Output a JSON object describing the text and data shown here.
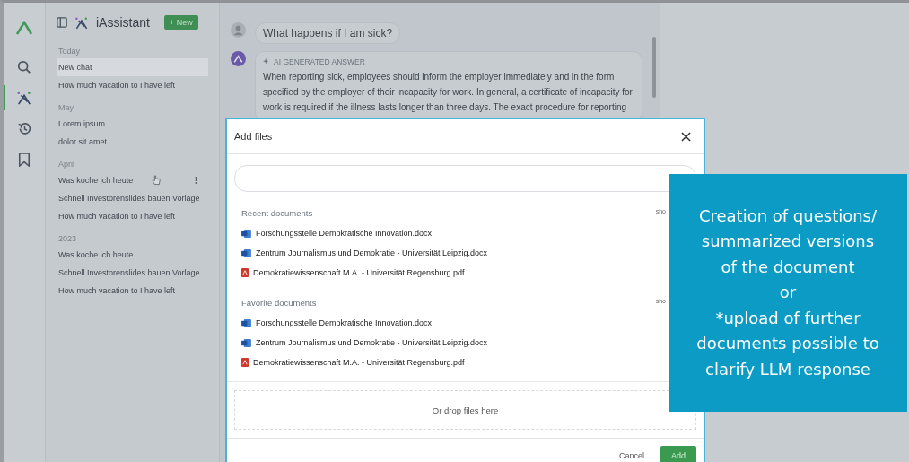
{
  "rail": {
    "items": [
      {
        "kind": "search",
        "selected": false
      },
      {
        "kind": "assistant",
        "selected": true
      },
      {
        "kind": "history",
        "selected": false
      },
      {
        "kind": "bookmark",
        "selected": false
      }
    ]
  },
  "sidebar": {
    "title": "iAssistant",
    "new_button": "+ New",
    "sections": [
      {
        "heading": "Today",
        "items": [
          {
            "label": "New chat",
            "selected": true,
            "menu_visible": false
          },
          {
            "label": "How much vacation to I have left",
            "selected": false,
            "menu_visible": false
          }
        ]
      },
      {
        "heading": "May",
        "items": [
          {
            "label": "Lorem ipsum",
            "selected": false,
            "menu_visible": false
          },
          {
            "label": "dolor sit amet",
            "selected": false,
            "menu_visible": false
          }
        ]
      },
      {
        "heading": "April",
        "items": [
          {
            "label": "Was koche ich heute",
            "selected": false,
            "menu_visible": true
          },
          {
            "label": "Schnell Investorenslides bauen Vorlage",
            "selected": false,
            "menu_visible": false
          },
          {
            "label": "How much vacation to I have left",
            "selected": false,
            "menu_visible": false
          }
        ]
      },
      {
        "heading": "2023",
        "items": [
          {
            "label": "Was koche ich heute",
            "selected": false,
            "menu_visible": false
          },
          {
            "label": "Schnell Investorenslides bauen Vorlage",
            "selected": false,
            "menu_visible": false
          },
          {
            "label": "How much vacation to I have left",
            "selected": false,
            "menu_visible": false
          }
        ]
      }
    ]
  },
  "chat": {
    "question": "What happens if I am sick?",
    "answer_label": "AI GENERATED ANSWER",
    "answer": "When reporting sick, employees should inform the employer immediately and in the form specified by the employer of their incapacity for work. In general, a certificate of incapacity for work is required if the illness lasts longer than three days. The exact procedure for reporting"
  },
  "dialog": {
    "title": "Add files",
    "sections": [
      {
        "heading": "Recent documents",
        "link": "sho",
        "files": [
          {
            "kind": "docx",
            "name": "Forschungsstelle Demokratische Innovation.docx"
          },
          {
            "kind": "docx",
            "name": "Zentrum Journalismus und Demokratie - Universität Leipzig.docx"
          },
          {
            "kind": "pdf",
            "name": "Demokratiewissenschaft M.A. - Universität Regensburg.pdf"
          }
        ]
      },
      {
        "heading": "Favorite documents",
        "link": "sho",
        "files": [
          {
            "kind": "docx",
            "name": "Forschungsstelle Demokratische Innovation.docx"
          },
          {
            "kind": "docx",
            "name": "Zentrum Journalismus und Demokratie - Universität Leipzig.docx"
          },
          {
            "kind": "pdf",
            "name": "Demokratiewissenschaft M.A. - Universität Regensburg.pdf"
          }
        ]
      }
    ],
    "drop_zone": "Or drop files here",
    "buttons": {
      "cancel": "Cancel",
      "add": "Add"
    }
  },
  "callout": {
    "text": "Creation of questions/\nsummarized versions\nof the document\nor\n*upload of further\ndocuments possible to\nclarify LLM response"
  }
}
